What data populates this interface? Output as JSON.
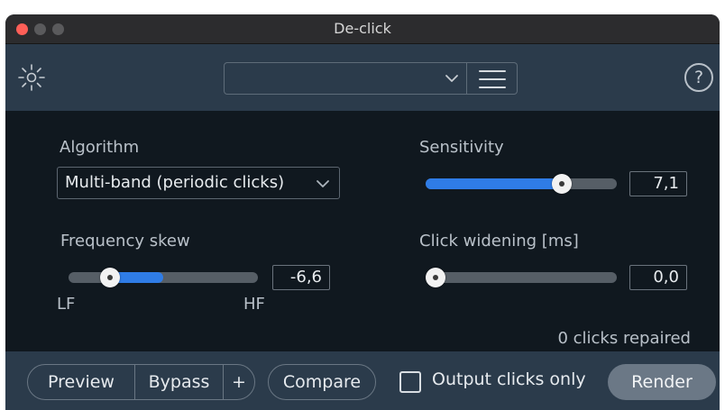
{
  "window": {
    "title": "De-click"
  },
  "header": {
    "module_icon": "sun-icon",
    "preset_value": "",
    "menu_icon": "hamburger-icon",
    "help_label": "?"
  },
  "algorithm": {
    "label": "Algorithm",
    "value": "Multi-band (periodic clicks)"
  },
  "sensitivity": {
    "label": "Sensitivity",
    "value": "7,1",
    "level": 0.71
  },
  "frequency_skew": {
    "label": "Frequency skew",
    "value": "-6,6",
    "left_label": "LF",
    "right_label": "HF",
    "level": 0.17
  },
  "click_widening": {
    "label": "Click widening [ms]",
    "value": "0,0",
    "level": 0.0
  },
  "status": {
    "clicks_repaired": "0 clicks repaired"
  },
  "footer": {
    "preview_label": "Preview",
    "bypass_label": "Bypass",
    "plus_label": "+",
    "compare_label": "Compare",
    "output_clicks_only_label": "Output clicks only",
    "output_clicks_only_checked": false,
    "render_label": "Render"
  },
  "colors": {
    "accent": "#2f7ce6",
    "panel": "#10181f",
    "header": "#2b3b4b",
    "close": "#ff5f57"
  }
}
